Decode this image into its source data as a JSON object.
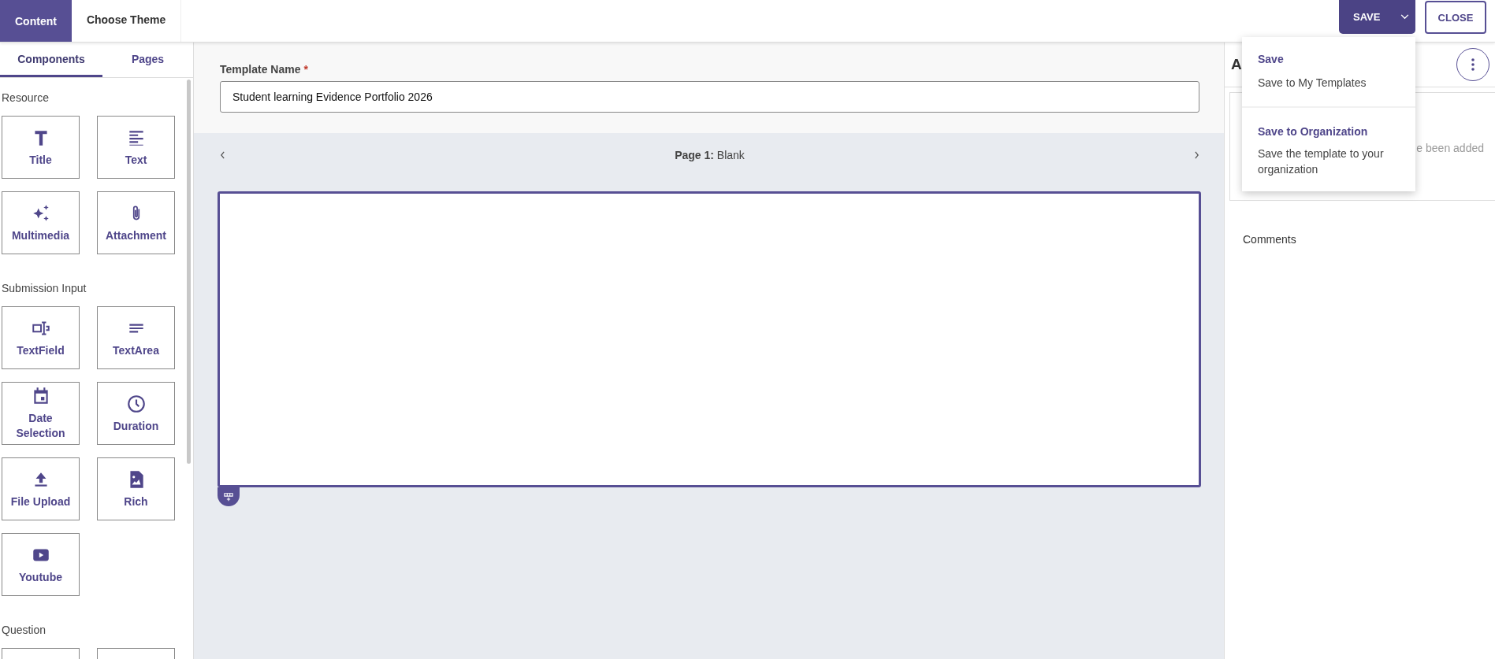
{
  "header": {
    "tabs": [
      {
        "label": "Content",
        "selected": true
      },
      {
        "label": "Choose Theme",
        "selected": false
      }
    ],
    "save_button": "SAVE",
    "close_button": "CLOSE"
  },
  "save_menu": {
    "expanded": true,
    "items": [
      {
        "title": "Save",
        "description": "Save to My Templates"
      },
      {
        "title": "Save to Organization",
        "description": "Save the template to your organization"
      }
    ]
  },
  "sidebar": {
    "tabs": [
      {
        "label": "Components",
        "selected": true
      },
      {
        "label": "Pages",
        "selected": false
      }
    ],
    "sections": [
      {
        "title": "Resource",
        "items": [
          "Title",
          "Text",
          "Multimedia",
          "Attachment"
        ]
      },
      {
        "title": "Submission Input",
        "items": [
          "TextField",
          "TextArea",
          "Date Selection",
          "Duration",
          "File Upload",
          "Rich",
          "Youtube"
        ]
      },
      {
        "title": "Question"
      }
    ]
  },
  "editor": {
    "template_name": {
      "label": "Template Name",
      "required_mark": "*",
      "value": "Student learning Evidence Portfolio 2026"
    },
    "page_nav": {
      "label": "Page 1:",
      "name": "Blank"
    }
  },
  "right_panel": {
    "title": "A",
    "empty_text": "e been added",
    "comments_label": "Comments"
  }
}
